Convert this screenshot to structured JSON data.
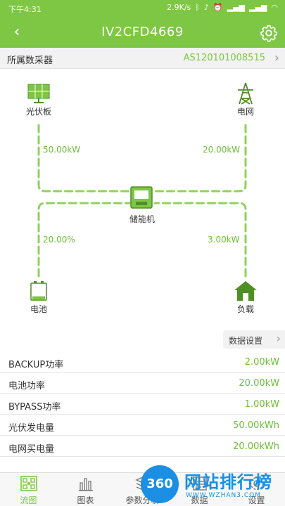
{
  "status_bar": {
    "time": "下午4:31",
    "network_speed": "2.9K/s",
    "icons": [
      "bluetooth-icon",
      "mute-icon",
      "alarm-icon",
      "signal-icon",
      "signal-icon",
      "wifi-icon"
    ]
  },
  "header": {
    "title": "IV2CFD4669",
    "back_icon": "chevron-left-icon",
    "settings_icon": "gear-icon"
  },
  "collector": {
    "label": "所属数采器",
    "value": "AS120101008515"
  },
  "flow": {
    "solar": {
      "label": "光伏板",
      "value": "50.00kW"
    },
    "grid": {
      "label": "电网",
      "value": "20.00kW"
    },
    "storage": {
      "label": "储能机"
    },
    "battery": {
      "label": "电池",
      "value": "20.00%"
    },
    "load": {
      "label": "负载",
      "value": "3.00kW"
    }
  },
  "data_settings": {
    "label": "数据设置"
  },
  "stats": [
    {
      "key": "BACKUP功率",
      "value": "2.00kW"
    },
    {
      "key": "电池功率",
      "value": "20.00kW"
    },
    {
      "key": "BYPASS功率",
      "value": "1.00kW"
    },
    {
      "key": "光伏发电量",
      "value": "50.00kWh"
    },
    {
      "key": "电网买电量",
      "value": "20.00kWh"
    }
  ],
  "tabs": [
    {
      "label": "流图",
      "icon": "flow-diagram-icon",
      "active": true
    },
    {
      "label": "图表",
      "icon": "bar-chart-icon",
      "active": false
    },
    {
      "label": "参数分析",
      "icon": "analysis-icon",
      "active": false
    },
    {
      "label": "数据",
      "icon": "data-icon",
      "active": false
    },
    {
      "label": "设置",
      "icon": "settings-icon",
      "active": false
    }
  ],
  "watermark": {
    "badge": "360",
    "title": "网站排行榜",
    "subtitle": "WWW.WZHAN3.COM"
  },
  "colors": {
    "brand_green": "#7dc744",
    "value_green": "#6cbf35",
    "dashed_line": "#8fd35a",
    "watermark_blue": "#1a8fe3"
  }
}
